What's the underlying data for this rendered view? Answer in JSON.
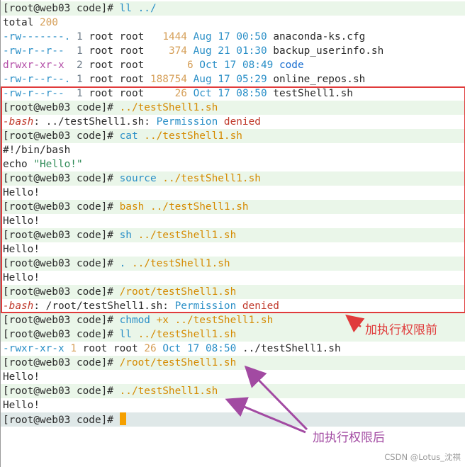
{
  "terminal": {
    "prompt": "[root@web03 code]# ",
    "l0_cmd": "ll ../",
    "total_label": "total ",
    "total_value": "200",
    "files": [
      {
        "perm": "-rw-------.",
        "links": "1",
        "owner": "root",
        "group": "root",
        "size": "1444",
        "month": "Aug",
        "day": "17",
        "time": "00:50",
        "name": "anaconda-ks.cfg"
      },
      {
        "perm": "-rw-r--r--",
        "links": "1",
        "owner": "root",
        "group": "root",
        "size": "374",
        "month": "Aug",
        "day": "21",
        "time": "01:30",
        "name": "backup_userinfo.sh"
      },
      {
        "perm": "drwxr-xr-x",
        "links": "2",
        "owner": "root",
        "group": "root",
        "size": "6",
        "month": "Oct",
        "day": "17",
        "time": "08:49",
        "name": "code"
      },
      {
        "perm": "-rw-r--r--.",
        "links": "1",
        "owner": "root",
        "group": "root",
        "size": "188754",
        "month": "Aug",
        "day": "17",
        "time": "05:29",
        "name": "online_repos.sh"
      },
      {
        "perm": "-rw-r--r--",
        "links": "1",
        "owner": "root",
        "group": "root",
        "size": "26",
        "month": "Oct",
        "day": "17",
        "time": "08:50",
        "name": "testShell1.sh"
      }
    ],
    "cmd_run_rel": "../testShell1.sh",
    "bash_label": "-bash",
    "err1_path": ": ../testShell1.sh: ",
    "perm_word": "Permission",
    "denied_word": "denied",
    "cmd_cat": "cat",
    "cat_arg": "../testShell1.sh",
    "shebang": "#!/bin/bash",
    "echo_kw": "echo ",
    "echo_str": "\"Hello!\"",
    "cmd_source": "source",
    "cmd_bash": "bash",
    "cmd_sh": "sh",
    "cmd_dot": ".",
    "hello": "Hello!",
    "abs_path": "/root/testShell1.sh",
    "err2_path": ": /root/testShell1.sh: ",
    "cmd_chmod": "chmod",
    "chmod_arg": "+x",
    "cmd_ll": "ll",
    "ll_file": {
      "perm": "-rwxr-xr-x",
      "links": "1",
      "owner": "root",
      "group": "root",
      "size": "26",
      "month": "Oct",
      "day": "17",
      "time": "08:50",
      "name": "../testShell1.sh"
    }
  },
  "annotations": {
    "before": "加执行权限前",
    "after": "加执行权限后"
  },
  "watermark": "CSDN @Lotus_沈祺"
}
